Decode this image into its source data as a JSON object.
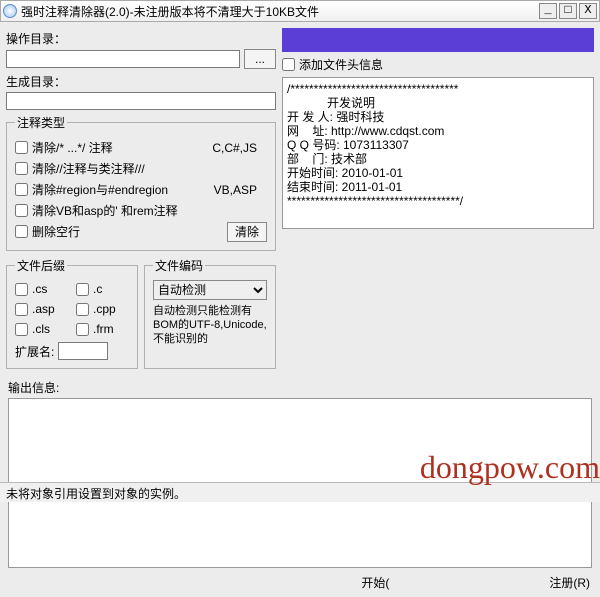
{
  "title": "强时注释清除器(2.0)-未注册版本将不清理大于10KB文件",
  "labels": {
    "opDir": "操作目录：",
    "outDir": "生成目录：",
    "browse": "...",
    "types": "注释类型",
    "t1": "清除/* ...*/ 注释",
    "l1": "C,C#,JS",
    "t2": "清除//注释与类注释///",
    "t3": "清除#region与#endregion",
    "l3": "VB,ASP",
    "t4": "清除VB和asp的' 和rem注释",
    "t5": "删除空行",
    "clearBtn": "清除",
    "suffix": "文件后缀",
    "s1": ".cs",
    "s2": ".c",
    "s3": ".asp",
    "s4": ".cpp",
    "s5": ".cls",
    "s6": ".frm",
    "extLabel": "扩展名:",
    "encoding": "文件编码",
    "encSel": "自动检测",
    "encHint": "自动检测只能检测有BOM的UTF-8,Unicode,不能识别的",
    "addHeader": "添加文件头信息",
    "devInfo": "/************************************\n            开发说明\n开 发 人: 强时科技\n网    址: http://www.cdqst.com\nQ Q 号码: 1073113307\n部    门: 技术部\n开始时间: 2010-01-01\n结束时间: 2011-01-01\n*************************************/",
    "outputInfo": "输出信息:",
    "start": "开始(",
    "register": "注册(R)",
    "status": "未将对象引用设置到对象的实例。"
  },
  "watermark": "dongpow.com"
}
